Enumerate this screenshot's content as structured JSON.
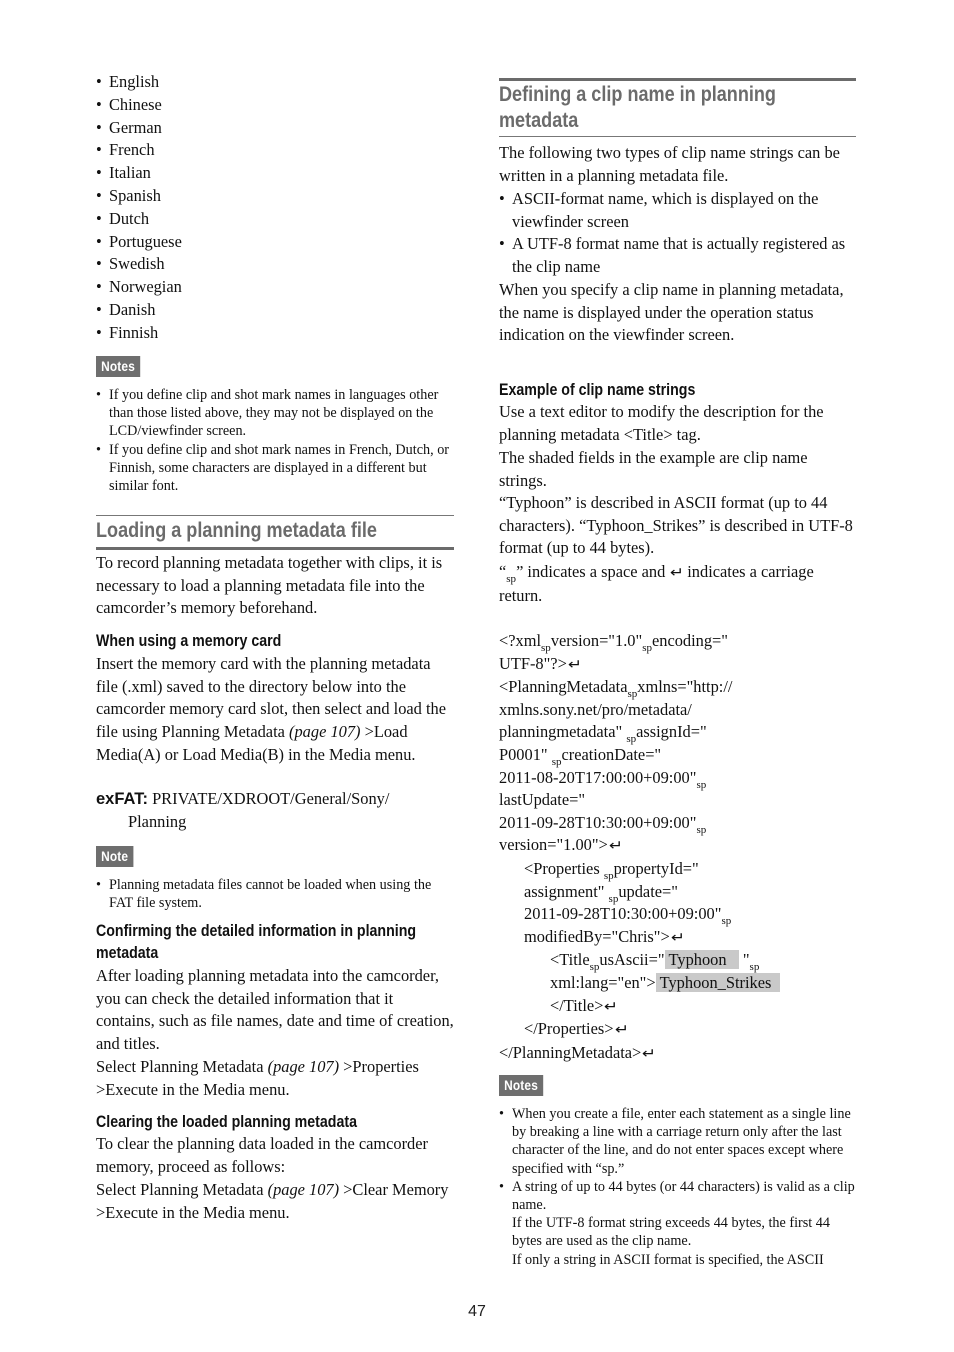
{
  "left_column": {
    "languages": [
      "English",
      "Chinese",
      "German",
      "French",
      "Italian",
      "Spanish",
      "Dutch",
      "Portuguese",
      "Swedish",
      "Norwegian",
      "Danish",
      "Finnish"
    ],
    "notes1": {
      "badge": "Notes",
      "items": [
        "If you define clip and shot mark names in languages other than those listed above, they may not be displayed on the LCD/viewfinder screen.",
        "If you define clip and shot mark names in French, Dutch, or Finnish, some characters are displayed in a different but similar font."
      ]
    },
    "loading_section": {
      "heading": "Loading a planning metadata file",
      "intro": "To record planning metadata together with clips, it is necessary to load a planning metadata file into the camcorder’s memory beforehand.",
      "memory_card": {
        "heading": "When using a memory card",
        "body": "Insert the memory card with the planning metadata file (.xml) saved to the directory below into the camcorder memory card slot, then select and load the file using Planning Metadata",
        "page_ref": "(page 107)",
        "body_after": " >Load Media(A) or Load Media(B) in the Media menu.",
        "exfat_label": "exFAT:",
        "exfat_path": " PRIVATE/XDROOT/General/Sony/",
        "exfat_path_cont": "Planning"
      },
      "note": {
        "badge": "Note",
        "items": [
          "Planning metadata files cannot be loaded when using the FAT file system."
        ]
      },
      "confirming": {
        "heading_line1": "Confirming the detailed information in planning",
        "heading_line2": "metadata",
        "body": "After loading planning metadata into the camcorder, you can check the detailed information that it contains, such as file names, date and time of creation, and titles.",
        "select_prefix": "Select Planning Metadata ",
        "page_ref": "(page 107)",
        "select_suffix": " >Properties >Execute in the Media menu."
      },
      "clearing": {
        "heading": "Clearing the loaded planning metadata",
        "body": "To clear the planning data loaded in the camcorder memory, proceed as follows:",
        "select_prefix": "Select Planning Metadata ",
        "page_ref": "(page 107)",
        "select_suffix": " >Clear Memory >Execute in the Media menu."
      }
    }
  },
  "right_column": {
    "defining_section": {
      "heading_line1": "Defining a clip name in planning",
      "heading_line2": "metadata",
      "intro": "The following two types of clip name strings can be written in a planning metadata file.",
      "bullets": [
        "ASCII-format name, which is displayed on the viewfinder screen",
        "A UTF-8 format name that is actually registered as the clip name"
      ],
      "after": "When you specify a clip name in planning metadata, the name is displayed under the operation status indication on the viewfinder screen."
    },
    "example": {
      "heading": "Example of clip name strings",
      "p1": "Use a text editor to modify the description for the planning metadata <Title> tag.",
      "p2": "The shaded fields in the example are clip name strings.",
      "p3": "“Typhoon” is described in ASCII format (up to 44 characters). “Typhoon_Strikes” is described in UTF-8 format (up to 44 bytes).",
      "p4_open": "“",
      "p4_sp": "sp",
      "p4_mid": "” indicates a space and ",
      "p4_end": " indicates a carriage return."
    },
    "code": {
      "sp": "sp",
      "return_glyph": "↵",
      "l01a": "<?xml",
      "l01b": "version=\"1.0\"",
      "l01c": "encoding=\"",
      "l02": "UTF-8\"?>",
      "l03a": "<PlanningMetadata",
      "l03b": "xmlns=\"http://",
      "l04": "xmlns.sony.net/pro/metadata/",
      "l05a": "planningmetadata\" ",
      "l05b": "assignId=\"",
      "l06a": "P0001\" ",
      "l06b": "creationDate=\"",
      "l07": "2011-08-20T17:00:00+09:00\"",
      "l08": "lastUpdate=\"",
      "l09": "2011-09-28T10:30:00+09:00\"",
      "l10": "version=\"1.00\">",
      "l11a": "<Properties ",
      "l11b": "propertyId=\"",
      "l12a": "assignment\" ",
      "l12b": "update=\"",
      "l13": "2011-09-28T10:30:00+09:00\"",
      "l14": "modifiedBy=\"Chris\">",
      "l15a": "<Title",
      "l15b": "usAscii=\"",
      "l15_shaded": "Typhoon  ",
      "l15c": " \"",
      "l16a": "xml:lang=\"en\">",
      "l16_shaded": "Typhoon_Strikes ",
      "l17": "</Title>",
      "l18": "</Properties>",
      "l19": "</PlanningMetadata>"
    },
    "notes2": {
      "badge": "Notes",
      "item1": "When you create a file, enter each statement as a single line by breaking a line with a carriage return only after the last character of the line, and do not enter spaces except where specified with “sp.”",
      "item2_l1": "A string of up to 44 bytes (or 44 characters) is valid as a clip name.",
      "item2_l2": "If the UTF-8 format string exceeds 44 bytes, the first 44 bytes are used as the clip name.",
      "item2_l3": "If only a string in ASCII format is specified, the ASCII"
    }
  },
  "footer": {
    "page_number": "47"
  }
}
